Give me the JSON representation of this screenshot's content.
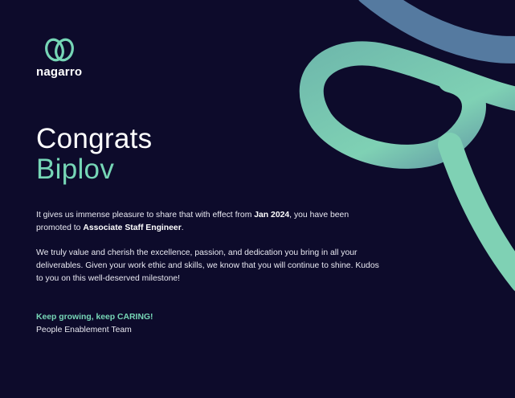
{
  "brand": {
    "name": "nagarro",
    "logo_color": "#76d6b6"
  },
  "headline": {
    "greeting": "Congrats",
    "name": "Biplov"
  },
  "message": {
    "p1_before_date": "It gives us immense pleasure to share that with effect from ",
    "effective_date": "Jan 2024",
    "p1_after_date": ", you have been promoted to ",
    "new_role": "Associate Staff Engineer",
    "p1_end": ".",
    "p2": "We truly value and cherish the excellence, passion, and dedication you bring in all your deliverables. Given your work ethic and skills, we know that you will continue to shine. Kudos to you on this well-deserved milestone!"
  },
  "signoff": {
    "tagline": "Keep growing, keep CARING!",
    "team": "People Enablement Team"
  },
  "colors": {
    "background": "#0d0b2b",
    "accent": "#76d6b6",
    "ribbon_light": "#7fd1b4",
    "ribbon_dark": "#4f6c9a"
  }
}
